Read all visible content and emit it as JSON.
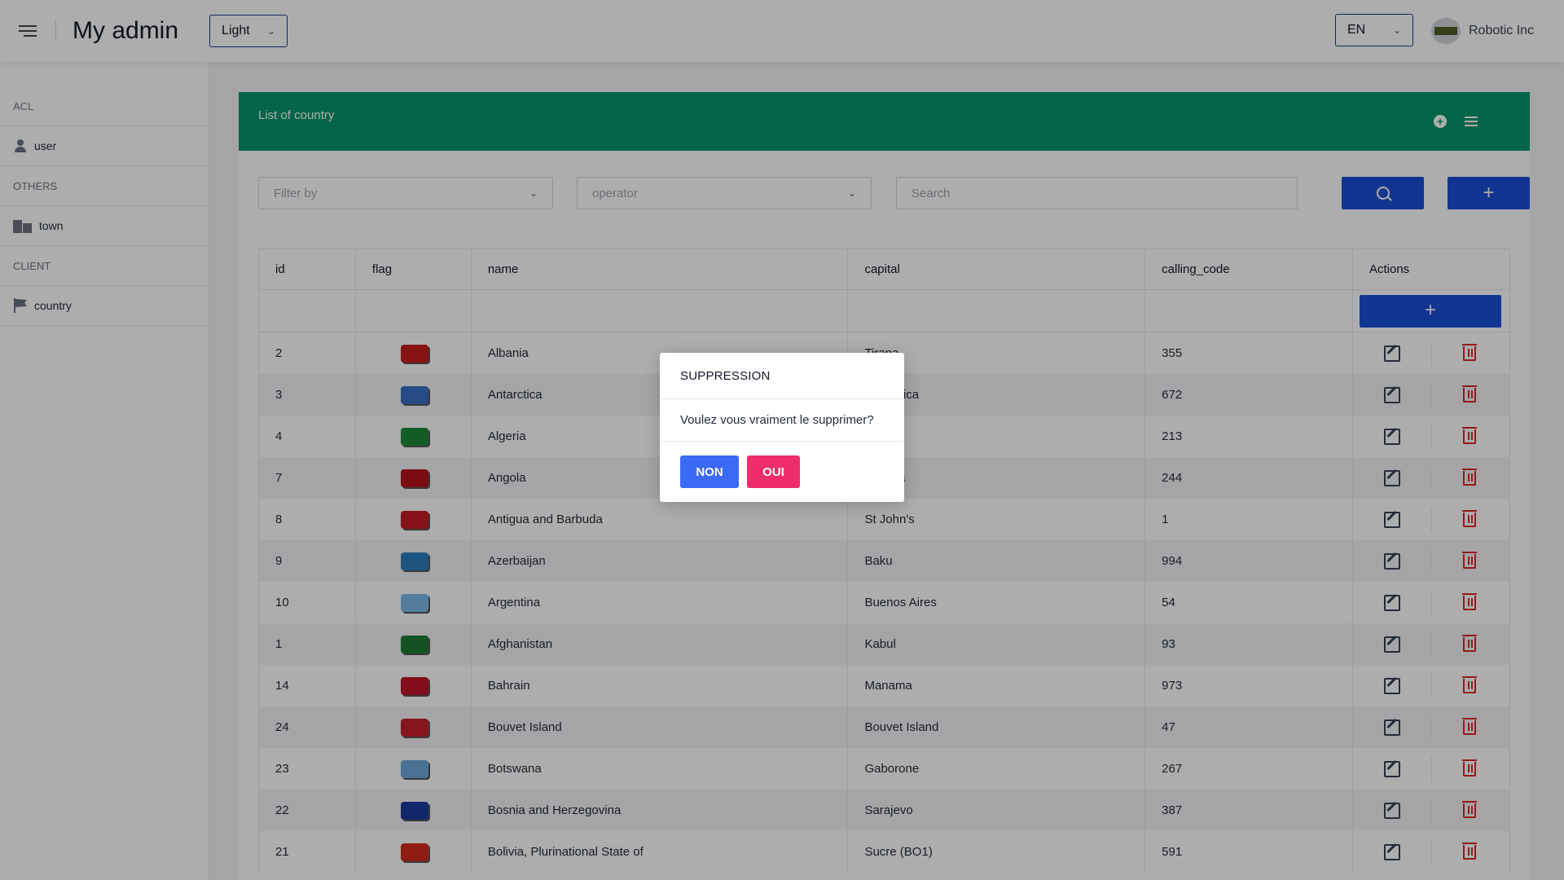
{
  "header": {
    "title": "My admin",
    "theme": "Light",
    "language": "EN",
    "company": "Robotic Inc"
  },
  "sidebar": {
    "sections": [
      {
        "label": "ACL",
        "items": [
          {
            "label": "user",
            "icon": "user-icon"
          }
        ]
      },
      {
        "label": "OTHERS",
        "items": [
          {
            "label": "town",
            "icon": "city-icon"
          }
        ]
      },
      {
        "label": "CLIENT",
        "items": [
          {
            "label": "country",
            "icon": "flag-icon"
          }
        ]
      }
    ]
  },
  "card": {
    "title": "List of country",
    "filters": {
      "filter_by_placeholder": "Filter by",
      "operator_placeholder": "operator",
      "search_placeholder": "Search"
    },
    "table": {
      "columns": [
        "id",
        "flag",
        "name",
        "capital",
        "calling_code",
        "Actions"
      ],
      "rows": [
        {
          "id": "2",
          "name": "Albania",
          "capital": "Tirana",
          "calling_code": "355",
          "flag_color": "#c81d1d"
        },
        {
          "id": "3",
          "name": "Antarctica",
          "capital": "Antarctica",
          "calling_code": "672",
          "flag_color": "#3a6fc4"
        },
        {
          "id": "4",
          "name": "Algeria",
          "capital": "Algiers",
          "calling_code": "213",
          "flag_color": "#1f8a3a"
        },
        {
          "id": "7",
          "name": "Angola",
          "capital": "Luanda",
          "calling_code": "244",
          "flag_color": "#b3141c"
        },
        {
          "id": "8",
          "name": "Antigua and Barbuda",
          "capital": "St John's",
          "calling_code": "1",
          "flag_color": "#c41d25"
        },
        {
          "id": "9",
          "name": "Azerbaijan",
          "capital": "Baku",
          "calling_code": "994",
          "flag_color": "#2f7fbf"
        },
        {
          "id": "10",
          "name": "Argentina",
          "capital": "Buenos Aires",
          "calling_code": "54",
          "flag_color": "#7db9e8"
        },
        {
          "id": "1",
          "name": "Afghanistan",
          "capital": "Kabul",
          "calling_code": "93",
          "flag_color": "#1d7a34"
        },
        {
          "id": "14",
          "name": "Bahrain",
          "capital": "Manama",
          "calling_code": "973",
          "flag_color": "#c0152b"
        },
        {
          "id": "24",
          "name": "Bouvet Island",
          "capital": "Bouvet Island",
          "calling_code": "47",
          "flag_color": "#c8202f"
        },
        {
          "id": "23",
          "name": "Botswana",
          "capital": "Gaborone",
          "calling_code": "267",
          "flag_color": "#6fa8dc"
        },
        {
          "id": "22",
          "name": "Bosnia and Herzegovina",
          "capital": "Sarajevo",
          "calling_code": "387",
          "flag_color": "#1a3a9c"
        },
        {
          "id": "21",
          "name": "Bolivia, Plurinational State of",
          "capital": "Sucre (BO1)",
          "calling_code": "591",
          "flag_color": "#d52b1e"
        }
      ]
    }
  },
  "modal": {
    "title": "SUPPRESSION",
    "message": "Voulez vous vraiment le supprimer?",
    "cancel_label": "NON",
    "confirm_label": "OUI"
  },
  "colors": {
    "header_green": "#059669",
    "primary_blue": "#1d4ed8",
    "confirm_pink": "#ef2d6a",
    "cancel_blue": "#3b6bf5"
  }
}
